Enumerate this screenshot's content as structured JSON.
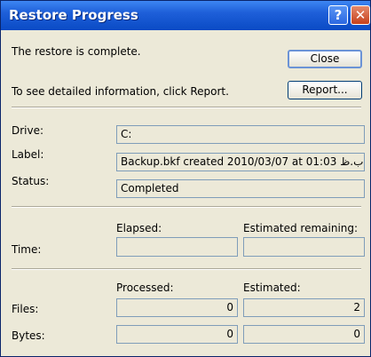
{
  "window": {
    "title": "Restore Progress",
    "help_glyph": "?",
    "close_glyph": "✕"
  },
  "message": {
    "complete": "The restore is complete.",
    "report_hint": "To see detailed information, click Report."
  },
  "buttons": {
    "close": "Close",
    "report": "Report..."
  },
  "info": {
    "drive_label": "Drive:",
    "drive_value": "C:",
    "label_label": "Label:",
    "label_value": "Backup.bkf created 2010/03/07 at 01:03 ب.ظ",
    "status_label": "Status:",
    "status_value": "Completed"
  },
  "time": {
    "row_label": "Time:",
    "elapsed_header": "Elapsed:",
    "remaining_header": "Estimated remaining:",
    "elapsed_value": "",
    "remaining_value": ""
  },
  "counts": {
    "processed_header": "Processed:",
    "estimated_header": "Estimated:",
    "files_label": "Files:",
    "files_processed": "0",
    "files_estimated": "2",
    "bytes_label": "Bytes:",
    "bytes_processed": "0",
    "bytes_estimated": "0"
  }
}
